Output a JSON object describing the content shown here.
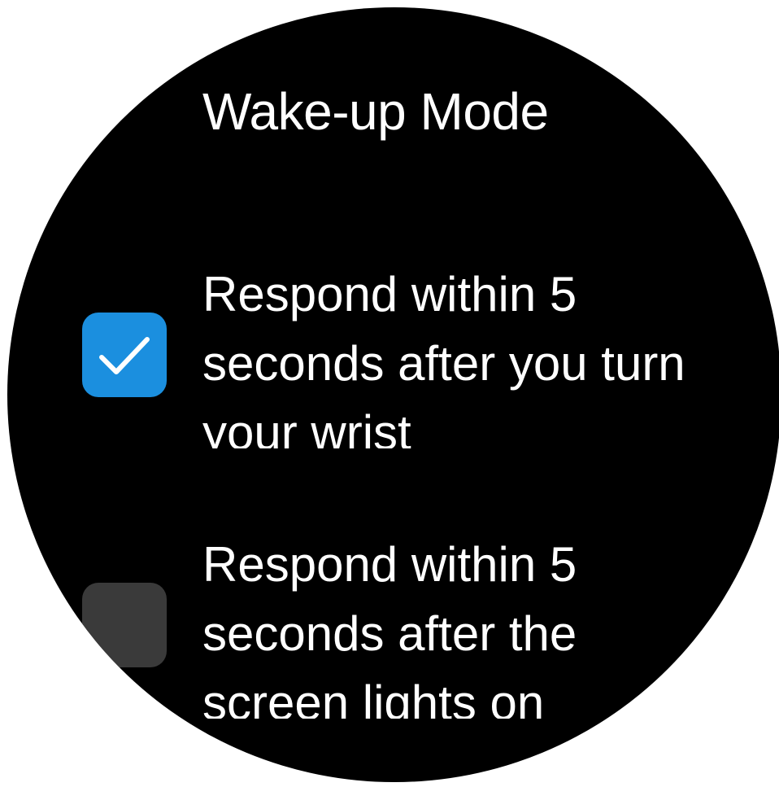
{
  "screen": {
    "title": "Wake-up Mode"
  },
  "options": [
    {
      "lines": [
        "Respond within 5",
        "seconds after you turn",
        "your wrist"
      ],
      "checked": true
    },
    {
      "lines": [
        "Respond within 5",
        "seconds after the",
        "screen lights on"
      ],
      "checked": false
    }
  ],
  "colors": {
    "background": "#000000",
    "text": "#ffffff",
    "checkbox_checked": "#1b8fdf",
    "checkbox_unchecked": "#3a3a3a",
    "checkmark": "#ffffff"
  },
  "icons": {
    "checked": "checkmark-icon"
  }
}
